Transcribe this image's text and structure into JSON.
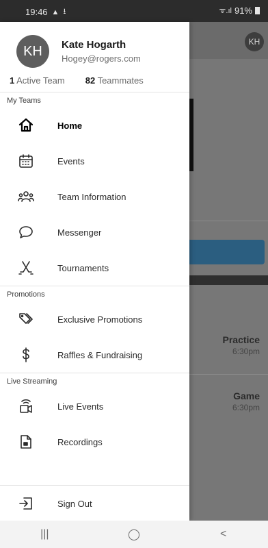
{
  "status_bar": {
    "time": "19:46",
    "left_icons": [
      "▲",
      "⭳"
    ],
    "battery": "91%",
    "signal": "ᯤ.ıl"
  },
  "profile": {
    "initials": "KH",
    "name": "Kate Hogarth",
    "email": "Hogey@rogers.com",
    "active_team_count": "1",
    "active_team_label": "Active Team",
    "teammates_count": "82",
    "teammates_label": "Teammates"
  },
  "sections": {
    "my_teams": "My Teams",
    "promotions": "Promotions",
    "live_streaming": "Live Streaming"
  },
  "menu": {
    "home": {
      "label": "Home",
      "icon": "home-icon"
    },
    "events": {
      "label": "Events",
      "icon": "calendar-icon"
    },
    "team_information": {
      "label": "Team Information",
      "icon": "group-icon"
    },
    "messenger": {
      "label": "Messenger",
      "icon": "chat-bubble-icon"
    },
    "tournaments": {
      "label": "Tournaments",
      "icon": "hockey-sticks-icon"
    },
    "exclusive_promotions": {
      "label": "Exclusive Promotions",
      "icon": "tags-icon"
    },
    "raffles": {
      "label": "Raffles & Fundraising",
      "icon": "dollar-icon"
    },
    "live_events": {
      "label": "Live Events",
      "icon": "live-camera-icon"
    },
    "recordings": {
      "label": "Recordings",
      "icon": "recording-file-icon"
    },
    "sign_out": {
      "label": "Sign Out",
      "icon": "sign-out-icon"
    }
  },
  "background": {
    "avatar": "KH",
    "events": [
      {
        "title": "Practice",
        "time": "6:30pm"
      },
      {
        "title": "Game",
        "time": "6:30pm"
      }
    ]
  },
  "nav_bar": {
    "recents": "|||",
    "home": "◯",
    "back": "<"
  },
  "colors": {
    "drawer_bg": "#ffffff",
    "scrim": "#777777",
    "accent_button": "#2b5e80"
  }
}
